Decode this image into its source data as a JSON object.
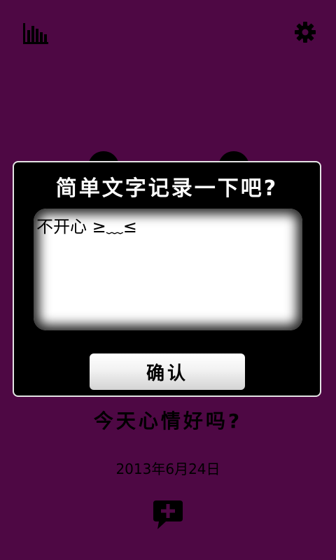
{
  "toolbar": {
    "stats_icon": "bar-chart-icon",
    "settings_icon": "gear-icon"
  },
  "dialog": {
    "title": "简单文字记录一下吧?",
    "note_value": "不开心 ≥﹏≤",
    "confirm_label": "确认"
  },
  "main": {
    "question": "今天心情好吗?",
    "date": "2013年6月24日",
    "add_note_icon": "add-comment-icon"
  },
  "colors": {
    "background": "#4e0844",
    "dialog_background": "#000000",
    "dialog_border": "#e4e4e4",
    "text": "#000000",
    "title_text": "#ffffff"
  }
}
